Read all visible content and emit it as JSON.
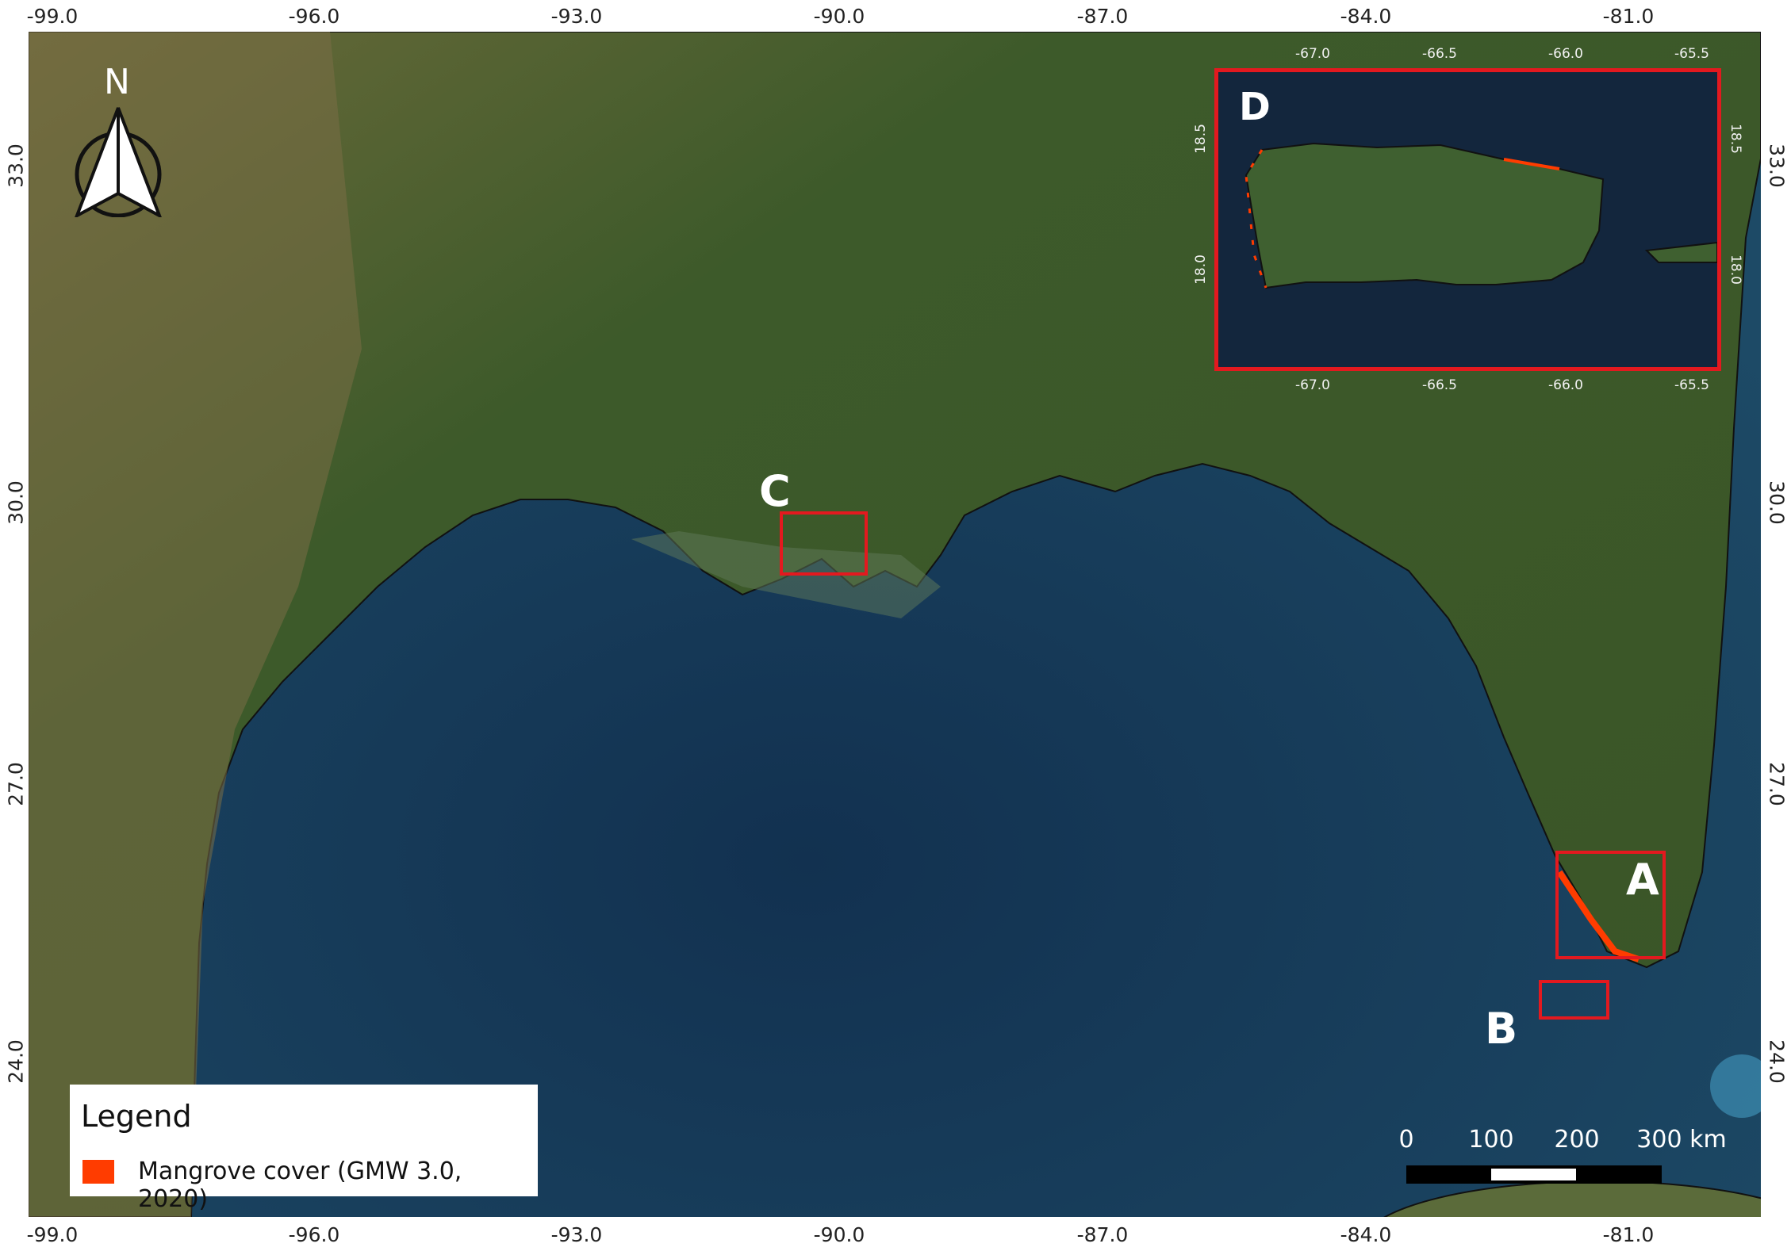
{
  "map": {
    "lon_ticks": [
      "-99.0",
      "-96.0",
      "-93.0",
      "-90.0",
      "-87.0",
      "-84.0",
      "-81.0"
    ],
    "lat_ticks": [
      "33.0",
      "30.0",
      "27.0",
      "24.0"
    ],
    "north_label": "N",
    "boxes": {
      "A": "A",
      "B": "B",
      "C": "C"
    }
  },
  "inset": {
    "label": "D",
    "lon_ticks": [
      "-67.0",
      "-66.5",
      "-66.0",
      "-65.5"
    ],
    "lat_ticks": [
      "18.5",
      "18.0"
    ]
  },
  "legend": {
    "title": "Legend",
    "items": [
      {
        "label": "Mangrove cover (GMW 3.0, 2020)",
        "color": "#ff3c00"
      }
    ]
  },
  "scale": {
    "ticks": [
      "0",
      "100",
      "200",
      "300 km"
    ]
  },
  "colors": {
    "box": "#e3191f",
    "ocean": "#163a57",
    "land": "#3f5a2a"
  }
}
